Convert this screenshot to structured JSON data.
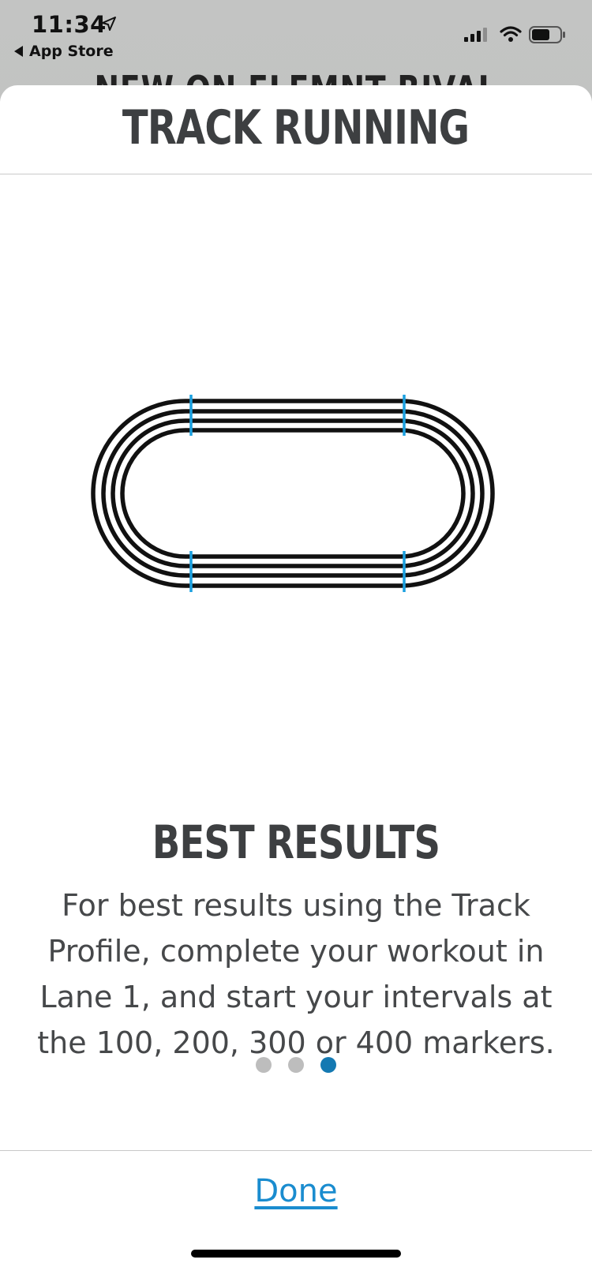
{
  "status_bar": {
    "time": "11:34",
    "back_label": "App Store"
  },
  "background_screen": {
    "title": "NEW ON ELEMNT RIVAL"
  },
  "sheet": {
    "title": "TRACK RUNNING"
  },
  "slide": {
    "heading": "BEST RESULTS",
    "body": "For best results using the Track Profile, complete your workout in Lane 1, and start your intervals at the 100, 200, 300 or 400 markers."
  },
  "pager": {
    "total": 3,
    "active_index": 2
  },
  "footer": {
    "done_label": "Done"
  },
  "colors": {
    "accent": "#1a8ccf",
    "active_dot": "#1479b2",
    "marker": "#1aa0e0",
    "heading": "#3d3f41"
  },
  "icons": {
    "location": "location-arrow-icon",
    "back": "back-triangle-icon",
    "signal": "cellular-signal-icon",
    "wifi": "wifi-icon",
    "battery": "battery-icon",
    "track": "running-track-icon"
  }
}
